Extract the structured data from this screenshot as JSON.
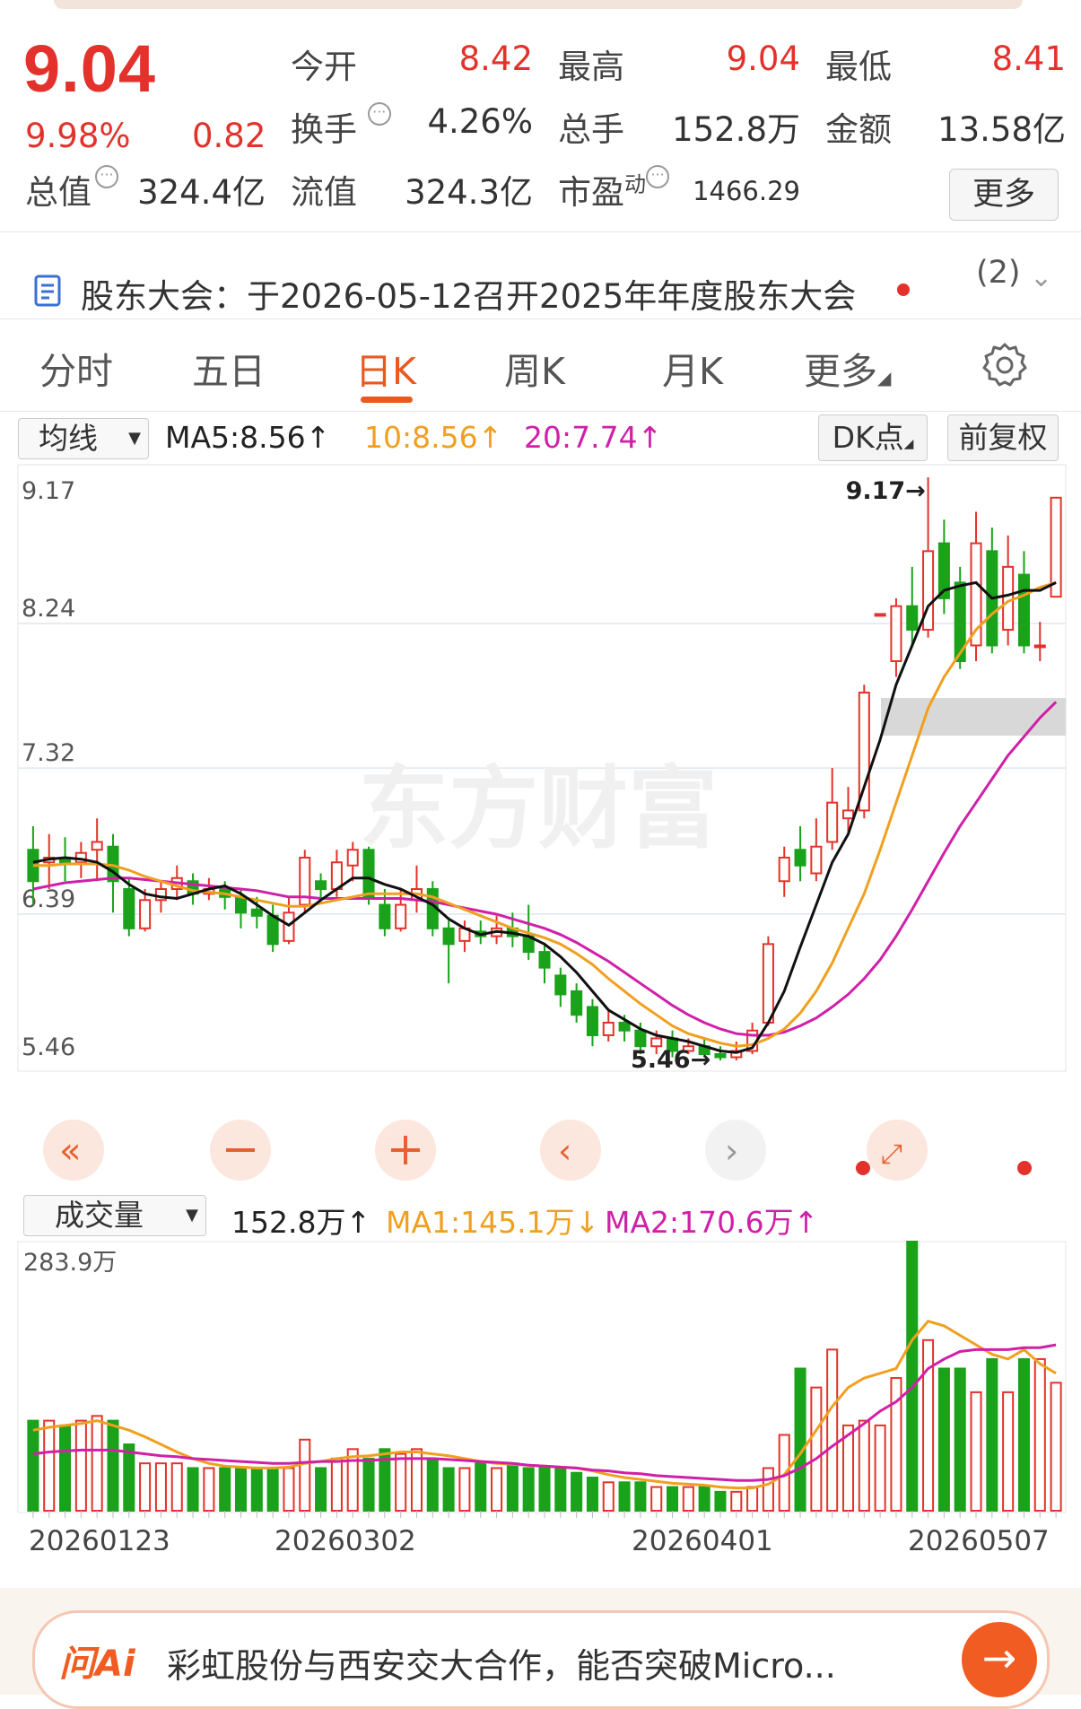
{
  "quote": {
    "price": "9.04",
    "change_pct": "9.98%",
    "change": "0.82",
    "open_label": "今开",
    "open": "8.42",
    "high_label": "最高",
    "high": "9.04",
    "low_label": "最低",
    "low": "8.41",
    "turnover_label": "换手",
    "turnover": "4.26%",
    "volume_label": "总手",
    "volume": "152.8万",
    "amount_label": "金额",
    "amount": "13.58亿",
    "mcap_label": "总值",
    "mcap": "324.4亿",
    "float_label": "流值",
    "float": "324.3亿",
    "pe_label": "市盈",
    "pe_sup": "动",
    "pe": "1466.29",
    "more_label": "更多"
  },
  "notice": {
    "text": "股东大会：于2026-05-12召开2025年年度股东大会",
    "count": "(2)"
  },
  "tabs": [
    "分时",
    "五日",
    "日K",
    "周K",
    "月K",
    "更多"
  ],
  "active_tab": "日K",
  "ma_bar": {
    "selector": "均线",
    "ma5": "MA5:8.56↑",
    "ma10": "10:8.56↑",
    "ma20": "20:7.74↑",
    "dk_label": "DK点",
    "adjust_label": "前复权"
  },
  "vol_bar": {
    "selector": "成交量",
    "vol": "152.8万↑",
    "ma1": "MA1:145.1万↓",
    "ma2": "MA2:170.6万↑"
  },
  "colors": {
    "up": "#e3322b",
    "down": "#1aa21a",
    "ma5": "#111111",
    "ma10": "#f0a020",
    "ma20": "#d020a8",
    "accent": "#e85a1f"
  },
  "chart_data": {
    "type": "candlestick",
    "price_axis": [
      "9.17",
      "8.24",
      "7.32",
      "6.39",
      "5.46"
    ],
    "ylim": [
      5.46,
      9.17
    ],
    "high_marker": "9.17→",
    "low_marker": "5.46→",
    "volume_axis_max": "283.9万",
    "dates": [
      "20260123",
      "20260302",
      "20260401",
      "20260507"
    ],
    "candles": [
      [
        6.8,
        6.6,
        6.95,
        6.45
      ],
      [
        6.72,
        6.75,
        6.9,
        6.55
      ],
      [
        6.75,
        6.72,
        6.88,
        6.6
      ],
      [
        6.72,
        6.78,
        6.85,
        6.62
      ],
      [
        6.8,
        6.85,
        7.0,
        6.6
      ],
      [
        6.82,
        6.6,
        6.9,
        6.4
      ],
      [
        6.55,
        6.3,
        6.62,
        6.25
      ],
      [
        6.3,
        6.48,
        6.55,
        6.28
      ],
      [
        6.48,
        6.55,
        6.6,
        6.4
      ],
      [
        6.55,
        6.62,
        6.7,
        6.48
      ],
      [
        6.6,
        6.52,
        6.65,
        6.45
      ],
      [
        6.52,
        6.55,
        6.62,
        6.48
      ],
      [
        6.55,
        6.5,
        6.6,
        6.42
      ],
      [
        6.5,
        6.4,
        6.55,
        6.3
      ],
      [
        6.42,
        6.38,
        6.5,
        6.3
      ],
      [
        6.38,
        6.2,
        6.45,
        6.15
      ],
      [
        6.22,
        6.4,
        6.5,
        6.2
      ],
      [
        6.45,
        6.75,
        6.8,
        6.4
      ],
      [
        6.6,
        6.55,
        6.65,
        6.48
      ],
      [
        6.55,
        6.72,
        6.8,
        6.5
      ],
      [
        6.7,
        6.8,
        6.85,
        6.6
      ],
      [
        6.8,
        6.5,
        6.82,
        6.45
      ],
      [
        6.45,
        6.3,
        6.55,
        6.25
      ],
      [
        6.3,
        6.45,
        6.55,
        6.28
      ],
      [
        6.48,
        6.55,
        6.7,
        6.4
      ],
      [
        6.55,
        6.3,
        6.6,
        6.25
      ],
      [
        6.3,
        6.2,
        6.35,
        5.95
      ],
      [
        6.22,
        6.3,
        6.35,
        6.15
      ],
      [
        6.28,
        6.25,
        6.35,
        6.2
      ],
      [
        6.25,
        6.3,
        6.38,
        6.2
      ],
      [
        6.3,
        6.25,
        6.4,
        6.18
      ],
      [
        6.25,
        6.15,
        6.45,
        6.1
      ],
      [
        6.15,
        6.05,
        6.2,
        5.95
      ],
      [
        6.0,
        5.88,
        6.05,
        5.8
      ],
      [
        5.9,
        5.75,
        5.95,
        5.7
      ],
      [
        5.8,
        5.62,
        5.85,
        5.55
      ],
      [
        5.62,
        5.7,
        5.78,
        5.58
      ],
      [
        5.7,
        5.65,
        5.75,
        5.58
      ],
      [
        5.65,
        5.55,
        5.7,
        5.5
      ],
      [
        5.55,
        5.6,
        5.65,
        5.5
      ],
      [
        5.6,
        5.52,
        5.65,
        5.48
      ],
      [
        5.52,
        5.55,
        5.6,
        5.5
      ],
      [
        5.55,
        5.5,
        5.6,
        5.48
      ],
      [
        5.5,
        5.48,
        5.55,
        5.46
      ],
      [
        5.48,
        5.52,
        5.58,
        5.46
      ],
      [
        5.52,
        5.65,
        5.7,
        5.5
      ],
      [
        5.7,
        6.2,
        6.25,
        5.68
      ],
      [
        6.6,
        6.75,
        6.82,
        6.5
      ],
      [
        6.8,
        6.7,
        6.95,
        6.6
      ],
      [
        6.65,
        6.82,
        7.0,
        6.6
      ],
      [
        6.85,
        7.1,
        7.32,
        6.8
      ],
      [
        7.0,
        7.05,
        7.2,
        6.9
      ],
      [
        7.05,
        7.8,
        7.85,
        7.0
      ],
      [
        8.3,
        8.3,
        8.3,
        8.3
      ],
      [
        8.0,
        8.35,
        8.4,
        7.9
      ],
      [
        8.35,
        8.2,
        8.6,
        8.1
      ],
      [
        8.2,
        8.7,
        9.17,
        8.15
      ],
      [
        8.75,
        8.4,
        8.9,
        8.3
      ],
      [
        8.5,
        8.0,
        8.6,
        7.95
      ],
      [
        8.1,
        8.75,
        8.95,
        8.0
      ],
      [
        8.7,
        8.1,
        8.85,
        8.05
      ],
      [
        8.2,
        8.6,
        8.8,
        8.1
      ],
      [
        8.55,
        8.1,
        8.7,
        8.05
      ],
      [
        8.1,
        8.1,
        8.25,
        8.0
      ],
      [
        8.41,
        9.04,
        9.04,
        8.41
      ]
    ],
    "volumes": [
      95,
      95,
      90,
      95,
      100,
      95,
      70,
      50,
      50,
      50,
      45,
      45,
      45,
      45,
      45,
      45,
      45,
      75,
      45,
      55,
      65,
      55,
      65,
      60,
      65,
      55,
      45,
      45,
      50,
      45,
      50,
      45,
      45,
      45,
      40,
      35,
      30,
      30,
      30,
      25,
      25,
      25,
      25,
      20,
      20,
      25,
      45,
      80,
      150,
      130,
      170,
      90,
      95,
      90,
      140,
      283.9,
      180,
      150,
      150,
      125,
      160,
      125,
      160,
      160,
      135
    ],
    "ma5": [
      6.72,
      6.74,
      6.75,
      6.74,
      6.72,
      6.66,
      6.58,
      6.52,
      6.5,
      6.49,
      6.52,
      6.55,
      6.57,
      6.52,
      6.45,
      6.38,
      6.32,
      6.4,
      6.48,
      6.55,
      6.62,
      6.62,
      6.58,
      6.55,
      6.5,
      6.45,
      6.36,
      6.3,
      6.26,
      6.28,
      6.27,
      6.25,
      6.2,
      6.12,
      6.02,
      5.9,
      5.78,
      5.72,
      5.66,
      5.62,
      5.6,
      5.58,
      5.55,
      5.52,
      5.51,
      5.54,
      5.7,
      5.9,
      6.18,
      6.45,
      6.72,
      6.9,
      7.2,
      7.5,
      7.85,
      8.1,
      8.35,
      8.45,
      8.48,
      8.5,
      8.4,
      8.42,
      8.45,
      8.45,
      8.5
    ],
    "ma10": [
      6.7,
      6.7,
      6.71,
      6.71,
      6.71,
      6.7,
      6.67,
      6.63,
      6.6,
      6.57,
      6.54,
      6.53,
      6.52,
      6.5,
      6.48,
      6.46,
      6.44,
      6.44,
      6.46,
      6.48,
      6.5,
      6.52,
      6.52,
      6.52,
      6.52,
      6.5,
      6.46,
      6.42,
      6.38,
      6.34,
      6.3,
      6.27,
      6.24,
      6.2,
      6.14,
      6.07,
      5.98,
      5.9,
      5.82,
      5.75,
      5.68,
      5.63,
      5.6,
      5.57,
      5.55,
      5.56,
      5.6,
      5.66,
      5.76,
      5.9,
      6.08,
      6.3,
      6.52,
      6.8,
      7.1,
      7.4,
      7.7,
      7.9,
      8.05,
      8.2,
      8.3,
      8.38,
      8.42,
      8.47,
      8.5
    ],
    "ma20": [
      6.55,
      6.57,
      6.59,
      6.6,
      6.61,
      6.62,
      6.62,
      6.61,
      6.6,
      6.59,
      6.58,
      6.57,
      6.56,
      6.55,
      6.54,
      6.52,
      6.5,
      6.5,
      6.49,
      6.49,
      6.49,
      6.49,
      6.49,
      6.49,
      6.48,
      6.47,
      6.45,
      6.43,
      6.41,
      6.39,
      6.36,
      6.33,
      6.3,
      6.26,
      6.21,
      6.15,
      6.09,
      6.02,
      5.95,
      5.88,
      5.81,
      5.75,
      5.7,
      5.66,
      5.63,
      5.62,
      5.62,
      5.64,
      5.68,
      5.73,
      5.8,
      5.88,
      5.98,
      6.1,
      6.25,
      6.42,
      6.6,
      6.78,
      6.95,
      7.1,
      7.25,
      7.4,
      7.52,
      7.64,
      7.74
    ],
    "vol_ma1": [
      85,
      88,
      90,
      92,
      95,
      90,
      85,
      78,
      70,
      62,
      55,
      50,
      47,
      46,
      45,
      45,
      46,
      50,
      52,
      55,
      57,
      58,
      60,
      62,
      62,
      60,
      58,
      55,
      52,
      50,
      49,
      48,
      47,
      46,
      45,
      42,
      38,
      35,
      33,
      31,
      29,
      28,
      27,
      25,
      24,
      24,
      28,
      38,
      60,
      85,
      110,
      130,
      140,
      145,
      150,
      180,
      200,
      195,
      185,
      175,
      165,
      160,
      170,
      155,
      145
    ],
    "vol_ma2": [
      60,
      62,
      63,
      64,
      64,
      64,
      62,
      60,
      58,
      57,
      55,
      54,
      53,
      52,
      51,
      50,
      50,
      51,
      52,
      52,
      53,
      53,
      54,
      55,
      55,
      55,
      54,
      53,
      52,
      51,
      50,
      48,
      47,
      46,
      45,
      43,
      42,
      40,
      39,
      37,
      36,
      35,
      34,
      33,
      32,
      32,
      33,
      37,
      45,
      55,
      68,
      80,
      92,
      105,
      115,
      130,
      150,
      160,
      168,
      170,
      170,
      170,
      172,
      172,
      175
    ]
  },
  "ask": {
    "logo": "问Ai",
    "text": "彩虹股份与西安交大合作，能否突破Micro..."
  }
}
